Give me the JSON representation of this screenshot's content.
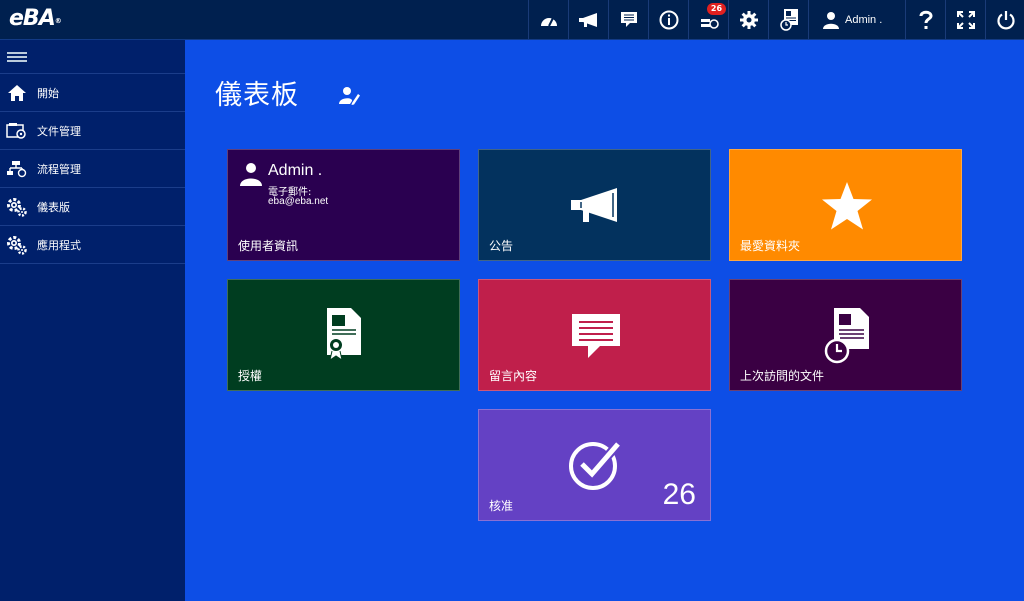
{
  "app": {
    "logo": "eBA",
    "logo_mark": "®"
  },
  "topbar": {
    "notification_count": "26",
    "user_name": "Admin ."
  },
  "sidebar": {
    "items": [
      {
        "label": "開始",
        "icon": "home-icon"
      },
      {
        "label": "文件管理",
        "icon": "document-management-icon"
      },
      {
        "label": "流程管理",
        "icon": "workflow-icon"
      },
      {
        "label": "儀表版",
        "icon": "gears-icon"
      },
      {
        "label": "應用程式",
        "icon": "gears-icon"
      }
    ]
  },
  "main": {
    "title": "儀表板",
    "tiles": [
      {
        "label": "使用者資訊",
        "color": "#2a0050",
        "user_name": "Admin .",
        "email_label": "電子郵件:",
        "email": "eba@eba.net"
      },
      {
        "label": "公告",
        "color": "#03325e"
      },
      {
        "label": "最愛資料夾",
        "color": "#ff8a00"
      },
      {
        "label": "授權",
        "color": "#003d20"
      },
      {
        "label": "留言內容",
        "color": "#c01f4b"
      },
      {
        "label": "上次訪問的文件",
        "color": "#3a0043"
      },
      {
        "label": "核准",
        "color": "#6441c4",
        "count": "26"
      }
    ]
  },
  "colors": {
    "background": "#0d4ee6",
    "topbar": "#00204f",
    "sidebar": "#00206b"
  }
}
